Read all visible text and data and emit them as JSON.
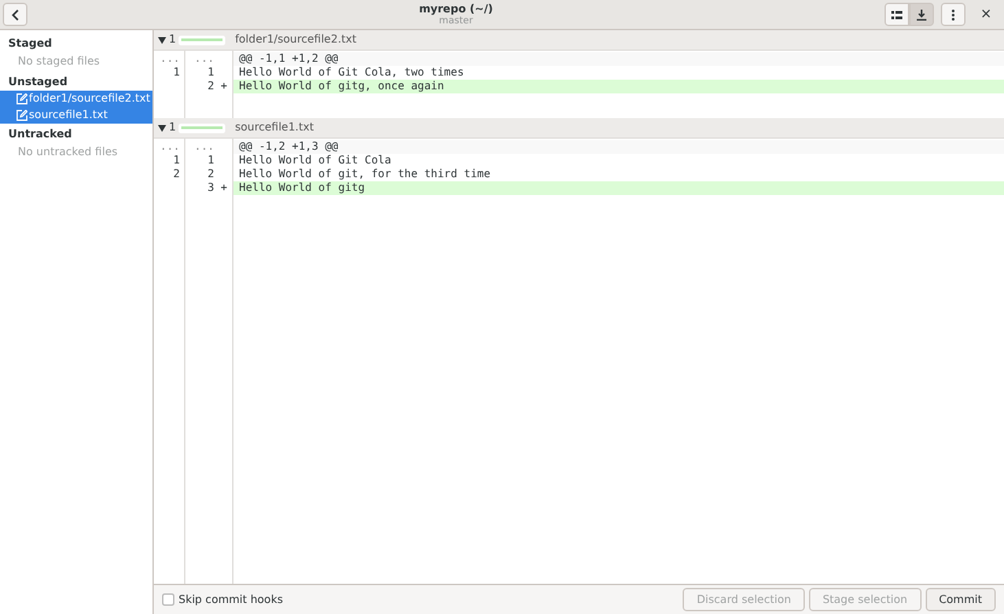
{
  "window": {
    "title": "myrepo (~/)",
    "subtitle": "master",
    "close": "×"
  },
  "toolbar": [
    {
      "kind": "list",
      "selected": false
    },
    {
      "kind": "download",
      "selected": true
    },
    {
      "kind": "menu",
      "selected": false
    }
  ],
  "sidebar": {
    "sections": [
      {
        "title": "Staged",
        "empty": "No staged files"
      },
      {
        "title": "Unstaged",
        "items": [
          {
            "label": "folder1/sourcefile2.txt",
            "selected": true
          },
          {
            "label": "sourcefile1.txt",
            "selected": true
          }
        ]
      },
      {
        "title": "Untracked",
        "empty": "No untracked files"
      }
    ]
  },
  "files": [
    {
      "count": "1",
      "name": "folder1/sourcefile2.txt",
      "expanded": true,
      "lines": [
        {
          "kind": "hunk",
          "old": "...",
          "new": "...",
          "text": "@@ -1,1 +1,2 @@"
        },
        {
          "kind": "context",
          "old": "1",
          "new": "1",
          "text": "Hello World of Git Cola, two times"
        },
        {
          "kind": "add",
          "new": "2",
          "sign": "+",
          "text": "Hello World of gitg, once again"
        }
      ]
    },
    {
      "count": "1",
      "name": "sourcefile1.txt",
      "expanded": true,
      "lines": [
        {
          "kind": "hunk",
          "old": "...",
          "new": "...",
          "text": "@@ -1,2 +1,3 @@"
        },
        {
          "kind": "context",
          "old": "1",
          "new": "1",
          "text": "Hello World of Git Cola"
        },
        {
          "kind": "context",
          "old": "2",
          "new": "2",
          "text": "Hello World of git, for the third time"
        },
        {
          "kind": "add",
          "new": "3",
          "sign": "+",
          "text": "Hello World of gitg"
        }
      ]
    }
  ],
  "footer": {
    "skip_hooks": {
      "label": "Skip commit hooks",
      "checked": false
    },
    "buttons": [
      {
        "label": "Discard selection",
        "disabled": true
      },
      {
        "label": "Stage selection",
        "disabled": true
      },
      {
        "label": "Commit",
        "disabled": false
      }
    ]
  }
}
